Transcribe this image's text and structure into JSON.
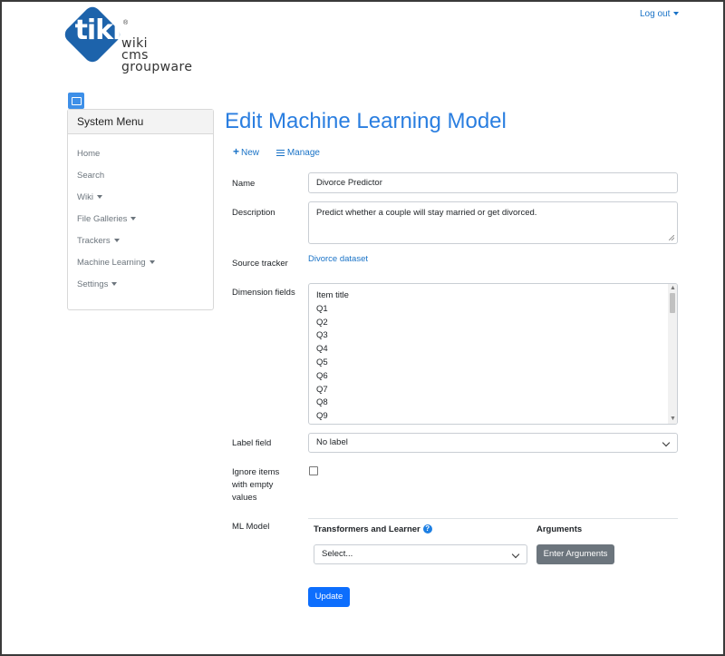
{
  "header": {
    "logout_label": "Log out"
  },
  "logo": {
    "mark": "tiki",
    "registered": "®",
    "line1": "wiki",
    "line2": "cms",
    "line3": "groupware"
  },
  "sidebar": {
    "title": "System Menu",
    "items": [
      {
        "label": "Home",
        "dropdown": false
      },
      {
        "label": "Search",
        "dropdown": false
      },
      {
        "label": "Wiki",
        "dropdown": true
      },
      {
        "label": "File Galleries",
        "dropdown": true
      },
      {
        "label": "Trackers",
        "dropdown": true
      },
      {
        "label": "Machine Learning",
        "dropdown": true
      },
      {
        "label": "Settings",
        "dropdown": true
      }
    ]
  },
  "page": {
    "title": "Edit Machine Learning Model",
    "new_label": "New",
    "manage_label": "Manage"
  },
  "form": {
    "name_label": "Name",
    "name_value": "Divorce Predictor",
    "description_label": "Description",
    "description_value": "Predict whether a couple will stay married or get divorced.",
    "source_tracker_label": "Source tracker",
    "source_tracker_value": "Divorce dataset",
    "dimension_fields_label": "Dimension fields",
    "dimension_fields": [
      "Item title",
      "Q1",
      "Q2",
      "Q3",
      "Q4",
      "Q5",
      "Q6",
      "Q7",
      "Q8",
      "Q9"
    ],
    "label_field_label": "Label field",
    "label_field_value": "No label",
    "ignore_items_label": "Ignore items with empty values",
    "ignore_items_checked": false,
    "ml_model_label": "ML Model",
    "transformers_header": "Transformers and Learner",
    "help_glyph": "?",
    "arguments_header": "Arguments",
    "learner_select_value": "Select...",
    "enter_arguments_label": "Enter Arguments",
    "update_label": "Update"
  },
  "colors": {
    "accent": "#2a7ee0",
    "link": "#1a73c7",
    "primary_button": "#0d6efd",
    "secondary_button": "#6c757d",
    "logo_blue": "#1d63ab"
  }
}
